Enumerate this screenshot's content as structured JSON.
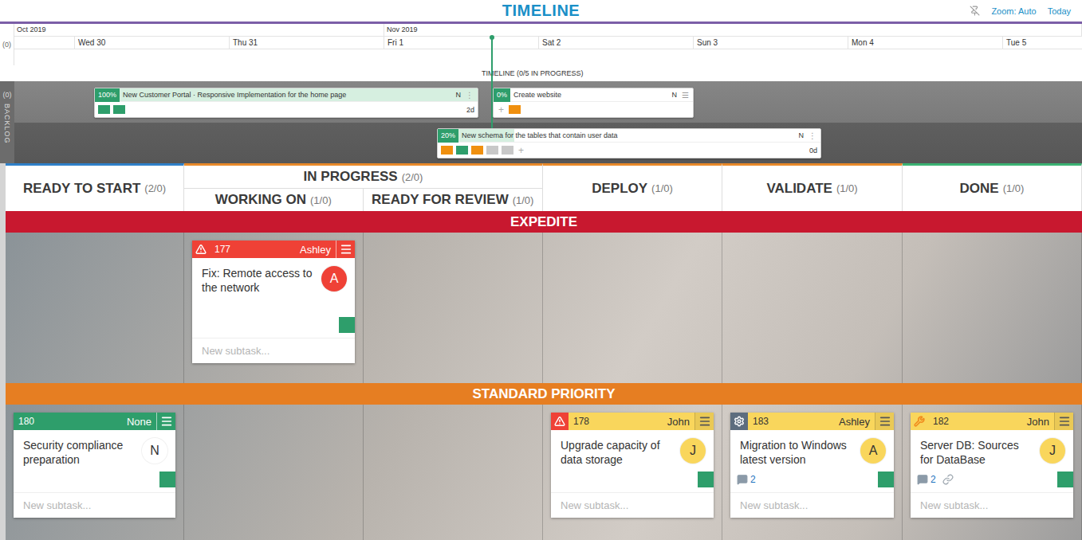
{
  "timeline": {
    "title": "TIMELINE",
    "zoom": "Zoom: Auto",
    "today": "Today",
    "count": "(0)",
    "months": [
      "Oct 2019",
      "Nov 2019"
    ],
    "days": [
      "Wed 30",
      "Thu 31",
      "Fri 1",
      "Sat 2",
      "Sun 3",
      "Mon 4",
      "Tue 5"
    ],
    "status": "TIMELINE (0/5 IN PROGRESS)",
    "lane": {
      "count": "(0)",
      "label": "BACKLOG"
    },
    "items": [
      {
        "percent": "100%",
        "level": 1,
        "title": "New Customer Portal · Responsive Implementation for the home page",
        "owner": "N",
        "menu": "⋮",
        "duration": "2d",
        "tasks": [
          {
            "kind": "task",
            "color": "#2e9e6b"
          },
          {
            "kind": "task",
            "color": "#2e9e6b"
          }
        ]
      },
      {
        "percent": "0%",
        "level": 0,
        "title": "Create website",
        "owner": "N",
        "menu": "☰",
        "tasks": [
          {
            "kind": "add",
            "text": "+"
          },
          {
            "kind": "task",
            "color": "#f0900f"
          }
        ]
      },
      {
        "percent": "20%",
        "level": 0.2,
        "title": "New schema for the tables that contain user data",
        "owner": "N",
        "menu": "⋮",
        "duration": "0d",
        "tasks": [
          {
            "kind": "task",
            "color": "#f0900f"
          },
          {
            "kind": "task",
            "color": "#2e9e6b"
          },
          {
            "kind": "task",
            "color": "#f0900f"
          },
          {
            "kind": "task",
            "color": "#c8c8c8"
          },
          {
            "kind": "task",
            "color": "#c8c8c8"
          },
          {
            "kind": "add",
            "text": "+"
          }
        ]
      }
    ]
  },
  "board": {
    "columns": [
      {
        "title": "READY TO START",
        "count": "(2/0)",
        "color": "#2f80c8"
      },
      {
        "title": "IN PROGRESS",
        "count": "(2/0)",
        "color": "#e8892a",
        "sub": [
          {
            "title": "WORKING ON",
            "count": "(1/0)"
          },
          {
            "title": "READY FOR REVIEW",
            "count": "(1/0)"
          }
        ]
      },
      {
        "title": "DEPLOY",
        "count": "(1/0)",
        "color": "#e8892a"
      },
      {
        "title": "VALIDATE",
        "count": "(1/0)",
        "color": "#e8892a"
      },
      {
        "title": "DONE",
        "count": "(1/0)",
        "color": "#3bb273"
      }
    ],
    "lanes": [
      {
        "title": "EXPEDITE",
        "color": "#c8182f",
        "cells": [
          {
            "cards": []
          },
          {
            "cards": [
              {
                "id": "177",
                "owner": "Ashley",
                "title": "Fix: Remote access to the network",
                "kind": "warning",
                "header_color": "#ef4136",
                "avatar": "A",
                "avatar_color": "#ef4136",
                "link": false,
                "tasks": [
                  {
                    "color": "#2e9e6b"
                  }
                ],
                "subtask": "New subtask..."
              }
            ]
          },
          {
            "cards": []
          },
          {
            "cards": []
          },
          {
            "cards": []
          },
          {
            "cards": []
          }
        ]
      },
      {
        "title": "STANDARD PRIORITY",
        "color": "#e67e22",
        "cells": [
          {
            "cards": [
              {
                "id": "180",
                "owner": "None",
                "title": "Security compliance preparation",
                "kind": "none",
                "header_color": "#2e9e6b",
                "avatar": "N",
                "avatar_color": "#ffffff",
                "link": false,
                "tasks": [
                  {
                    "color": "#2e9e6b"
                  }
                ],
                "subtask": "New subtask..."
              }
            ]
          },
          {
            "cards": []
          },
          {
            "cards": []
          },
          {
            "cards": [
              {
                "id": "178",
                "owner": "John",
                "title": "Upgrade capacity of data storage",
                "kind": "warning",
                "header_color": "#f9d65c",
                "avatar": "J",
                "avatar_color": "#f9d65c",
                "link": false,
                "tasks": [
                  {
                    "color": "#2e9e6b"
                  }
                ],
                "subtask": "New subtask..."
              }
            ]
          },
          {
            "cards": [
              {
                "id": "183",
                "owner": "Ashley",
                "title": "Migration to Windows latest version",
                "kind": "gear",
                "header_color": "#f9d65c",
                "avatar": "A",
                "avatar_color": "#f9d65c",
                "comments": "2",
                "link": false,
                "tasks": [
                  {
                    "color": "#2e9e6b"
                  }
                ],
                "subtask": "New subtask..."
              }
            ]
          },
          {
            "cards": [
              {
                "id": "182",
                "owner": "John",
                "title": "Server DB: Sources for DataBase",
                "kind": "wrench",
                "header_color": "#f9d65c",
                "avatar": "J",
                "avatar_color": "#f9d65c",
                "comments": "2",
                "link": true,
                "tasks": [
                  {
                    "color": "#2e9e6b"
                  }
                ],
                "subtask": "New subtask..."
              }
            ]
          }
        ]
      }
    ]
  }
}
